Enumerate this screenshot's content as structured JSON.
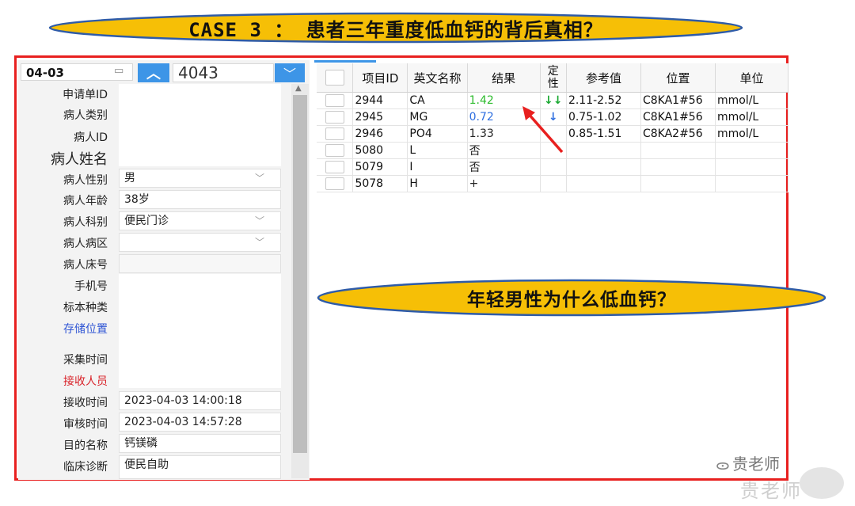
{
  "banner": {
    "text": "CASE 3 ： 患者三年重度低血钙的背后真相？",
    "fill": "#f6bf06",
    "stroke": "#2e5ba8"
  },
  "callout": {
    "text": "年轻男性为什么低血钙？",
    "fill": "#f6bf06",
    "stroke": "#2e5ba8"
  },
  "header": {
    "date": "04-03",
    "up_icon": "chevron-up-icon",
    "sample_number": "4043",
    "down_icon": "chevron-down-icon"
  },
  "form": {
    "rows": [
      {
        "label": "申请单ID",
        "value": ""
      },
      {
        "label": "病人类别",
        "value": ""
      },
      {
        "label": "病人ID",
        "value": ""
      },
      {
        "label": "病人姓名",
        "value": ""
      },
      {
        "label": "病人性别",
        "value": "男"
      },
      {
        "label": "病人年龄",
        "value": "38岁"
      },
      {
        "label": "病人科别",
        "value": "便民门诊"
      },
      {
        "label": "病人病区",
        "value": ""
      },
      {
        "label": "病人床号",
        "value": ""
      },
      {
        "label": "手机号",
        "value": ""
      },
      {
        "label": "标本种类",
        "value": ""
      },
      {
        "label": "存储位置",
        "value": ""
      },
      {
        "label": "采集时间",
        "value": ""
      },
      {
        "label": "接收人员",
        "value": ""
      },
      {
        "label": "接收时间",
        "value": "2023-04-03 14:00:18"
      },
      {
        "label": "审核时间",
        "value": "2023-04-03 14:57:28"
      },
      {
        "label": "目的名称",
        "value": "钙镁磷"
      },
      {
        "label": "临床诊断",
        "value": "便民自助"
      }
    ],
    "label_colors": {
      "storage": "#2f55d4",
      "receiver": "#d9232a"
    }
  },
  "table": {
    "headers": [
      "",
      "项目ID",
      "英文名称",
      "结果",
      "定性",
      "参考值",
      "位置",
      "单位"
    ],
    "rows": [
      {
        "id": "2944",
        "name": "CA",
        "result": "1.42",
        "flag": "↓↓",
        "ref": "2.11-2.52",
        "pos": "C8KA1#56",
        "unit": "mmol/L",
        "result_color": "#2ebc2e",
        "flag_color": "#18a830"
      },
      {
        "id": "2945",
        "name": "MG",
        "result": "0.72",
        "flag": "↓",
        "ref": "0.75-1.02",
        "pos": "C8KA1#56",
        "unit": "mmol/L",
        "result_color": "#2f6fe0",
        "flag_color": "#2f6fe0"
      },
      {
        "id": "2946",
        "name": "PO4",
        "result": "1.33",
        "flag": "",
        "ref": "0.85-1.51",
        "pos": "C8KA2#56",
        "unit": "mmol/L",
        "result_color": "#222222",
        "flag_color": "#222222"
      },
      {
        "id": "5080",
        "name": "L",
        "result": "否",
        "flag": "",
        "ref": "",
        "pos": "",
        "unit": "",
        "result_color": "#222222",
        "flag_color": "#222222"
      },
      {
        "id": "5079",
        "name": "I",
        "result": "否",
        "flag": "",
        "ref": "",
        "pos": "",
        "unit": "",
        "result_color": "#222222",
        "flag_color": "#222222"
      },
      {
        "id": "5078",
        "name": "H",
        "result": "+",
        "flag": "",
        "ref": "",
        "pos": "",
        "unit": "",
        "result_color": "#222222",
        "flag_color": "#222222"
      }
    ]
  },
  "watermark": {
    "name": "贵老师",
    "faded": "贵老师",
    "icon": "wechat-icon"
  },
  "colors": {
    "frame": "#e8201f",
    "accent": "#3d95e7",
    "arrow": "#e8201f"
  }
}
